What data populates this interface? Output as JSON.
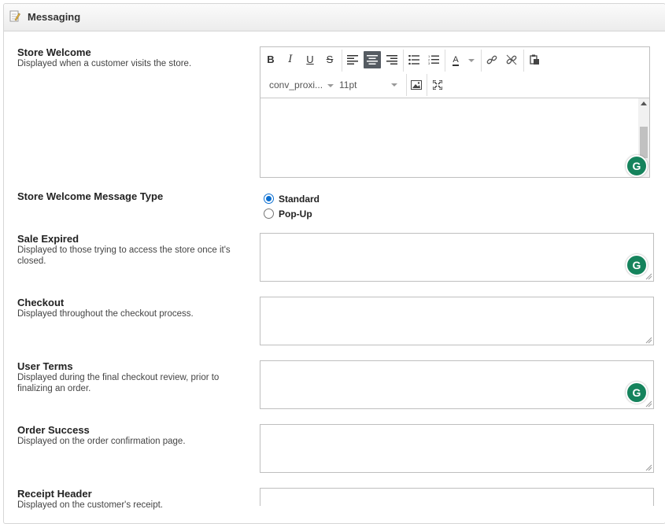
{
  "panel": {
    "title": "Messaging",
    "icon": "edit-note-icon"
  },
  "store_welcome": {
    "title": "Store Welcome",
    "description": "Displayed when a customer visits the store.",
    "editor": {
      "toolbar_row1": [
        "B",
        "I",
        "U",
        "S",
        "align-left",
        "align-center",
        "align-right",
        "bullet-list",
        "numbered-list",
        "A",
        "link",
        "unlink",
        "paste"
      ],
      "active_tool": "align-center",
      "font_name": "conv_proxi...",
      "font_size": "11pt"
    }
  },
  "message_type": {
    "title": "Store Welcome Message Type",
    "options": [
      {
        "label": "Standard",
        "selected": true
      },
      {
        "label": "Pop-Up",
        "selected": false
      }
    ]
  },
  "fields": [
    {
      "title": "Sale Expired",
      "description": "Displayed to those trying to access the store once it's closed.",
      "value": ""
    },
    {
      "title": "Checkout",
      "description": "Displayed throughout the checkout process.",
      "value": ""
    },
    {
      "title": "User Terms",
      "description": "Displayed during the final checkout review, prior to finalizing an order.",
      "value": ""
    },
    {
      "title": "Order Success",
      "description": "Displayed on the order confirmation page.",
      "value": ""
    },
    {
      "title": "Receipt Header",
      "description": "Displayed on the customer's receipt.",
      "value": ""
    }
  ],
  "grammarly_letter": "G",
  "colors": {
    "active_tool_bg": "#555b62",
    "grammarly": "#15835c",
    "radio": "#0a6ed1"
  }
}
